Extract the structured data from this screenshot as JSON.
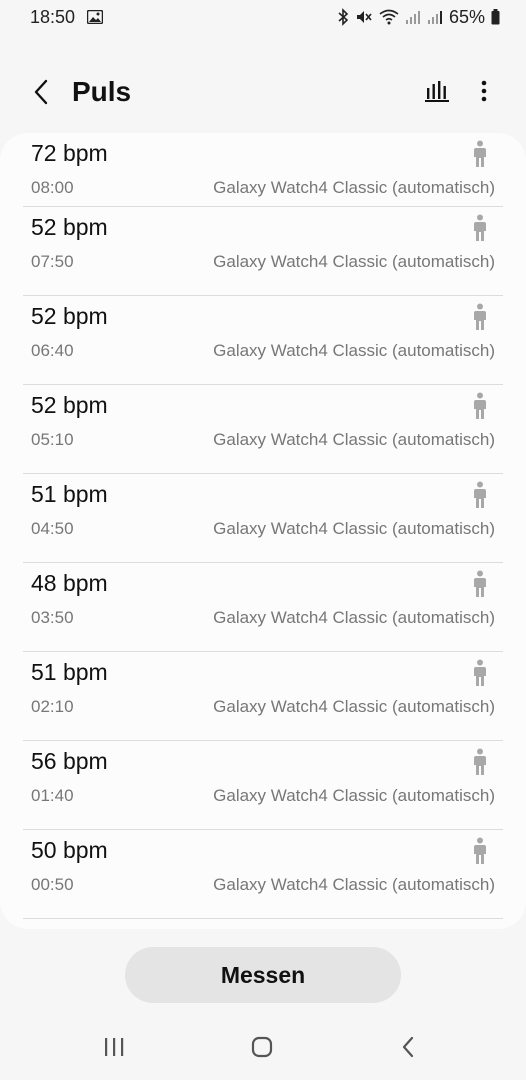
{
  "status_bar": {
    "time": "18:50",
    "battery_text": "65%",
    "icons": [
      "gallery-icon",
      "bluetooth-icon",
      "mute-icon",
      "wifi-icon",
      "signal-icon",
      "signal-icon",
      "battery-icon"
    ]
  },
  "header": {
    "title": "Puls",
    "back_icon": "chevron-left-icon",
    "chart_icon": "bar-chart-icon",
    "more_icon": "more-vertical-icon"
  },
  "records": [
    {
      "bpm": "72 bpm",
      "time": "08:00",
      "source": "Galaxy Watch4 Classic (automatisch)",
      "icon": "person-standing-icon"
    },
    {
      "bpm": "52 bpm",
      "time": "07:50",
      "source": "Galaxy Watch4 Classic (automatisch)",
      "icon": "person-standing-icon"
    },
    {
      "bpm": "52 bpm",
      "time": "06:40",
      "source": "Galaxy Watch4 Classic (automatisch)",
      "icon": "person-standing-icon"
    },
    {
      "bpm": "52 bpm",
      "time": "05:10",
      "source": "Galaxy Watch4 Classic (automatisch)",
      "icon": "person-standing-icon"
    },
    {
      "bpm": "51 bpm",
      "time": "04:50",
      "source": "Galaxy Watch4 Classic (automatisch)",
      "icon": "person-standing-icon"
    },
    {
      "bpm": "48 bpm",
      "time": "03:50",
      "source": "Galaxy Watch4 Classic (automatisch)",
      "icon": "person-standing-icon"
    },
    {
      "bpm": "51 bpm",
      "time": "02:10",
      "source": "Galaxy Watch4 Classic (automatisch)",
      "icon": "person-standing-icon"
    },
    {
      "bpm": "56 bpm",
      "time": "01:40",
      "source": "Galaxy Watch4 Classic (automatisch)",
      "icon": "person-standing-icon"
    },
    {
      "bpm": "50 bpm",
      "time": "00:50",
      "source": "Galaxy Watch4 Classic (automatisch)",
      "icon": "person-standing-icon"
    }
  ],
  "measure_button": {
    "label": "Messen"
  },
  "nav_bar": {
    "icons": [
      "recent-apps-icon",
      "home-icon",
      "back-icon"
    ]
  },
  "colors": {
    "background": "#f6f6f6",
    "card": "#fcfcfc",
    "secondary_text": "#777777",
    "button": "#e4e4e4"
  }
}
